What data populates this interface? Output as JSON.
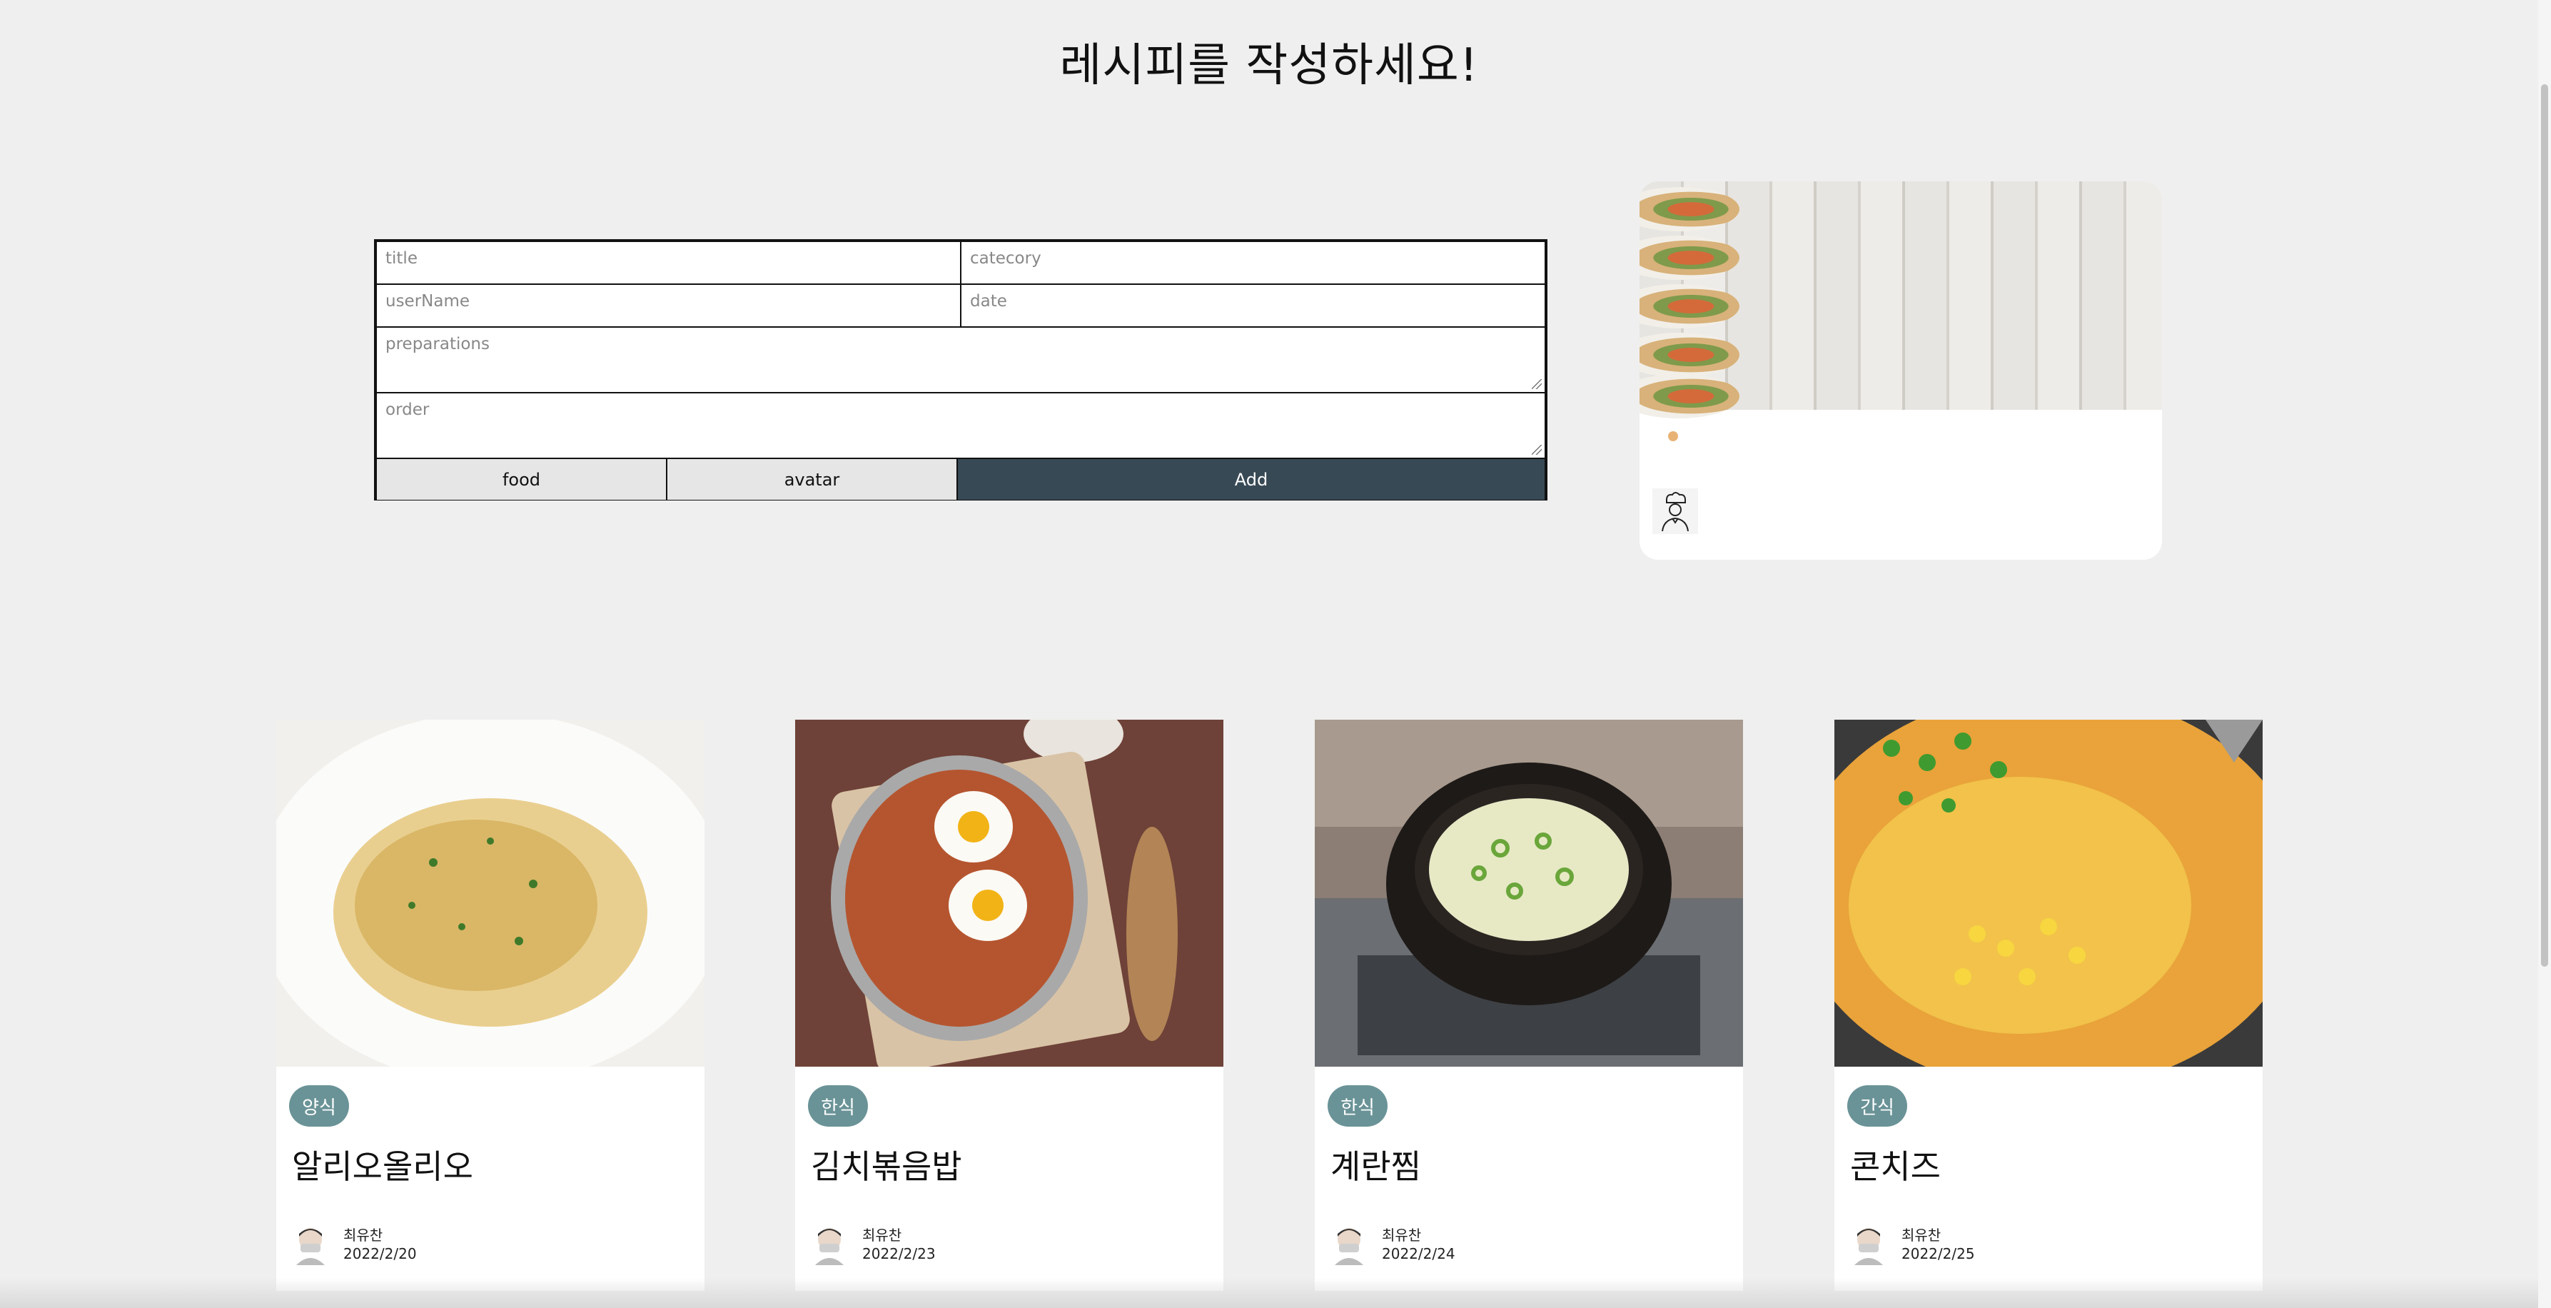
{
  "page": {
    "title": "레시피를 작성하세요!"
  },
  "form": {
    "title_placeholder": "title",
    "category_placeholder": "catecory",
    "username_placeholder": "userName",
    "date_placeholder": "date",
    "preparations_placeholder": "preparations",
    "order_placeholder": "order",
    "food_button": "food",
    "avatar_button": "avatar",
    "add_button": "Add"
  },
  "colors": {
    "add_button_bg": "#374955",
    "badge_bg": "#6a9397",
    "background": "#efefef"
  },
  "recipes": [
    {
      "category": "양식",
      "title": "알리오올리오",
      "author": "최유찬",
      "date": "2022/2/20"
    },
    {
      "category": "한식",
      "title": "김치볶음밥",
      "author": "최유찬",
      "date": "2022/2/23"
    },
    {
      "category": "한식",
      "title": "계란찜",
      "author": "최유찬",
      "date": "2022/2/24"
    },
    {
      "category": "간식",
      "title": "콘치즈",
      "author": "최유찬",
      "date": "2022/2/25"
    }
  ]
}
